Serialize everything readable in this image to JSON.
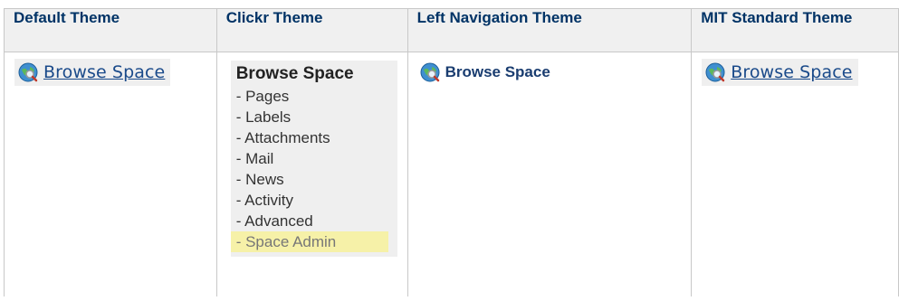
{
  "headers": [
    "Default Theme",
    "Clickr Theme",
    "Left Navigation Theme",
    "MIT Standard Theme"
  ],
  "default_theme": {
    "link": "Browse Space",
    "icon": "globe-search-icon"
  },
  "clickr_theme": {
    "title": "Browse Space",
    "items": [
      "- Pages",
      "- Labels",
      "- Attachments",
      "- Mail",
      "- News",
      "- Activity",
      "- Advanced",
      "- Space Admin"
    ],
    "highlight_color": "#f6f1a8"
  },
  "left_nav_theme": {
    "link": "Browse Space",
    "icon": "globe-search-icon"
  },
  "mit_theme": {
    "link": "Browse Space",
    "icon": "globe-search-icon"
  },
  "colors": {
    "header_text": "#003366",
    "link": "#1a4a8a",
    "header_bg": "#f0f0f0"
  }
}
